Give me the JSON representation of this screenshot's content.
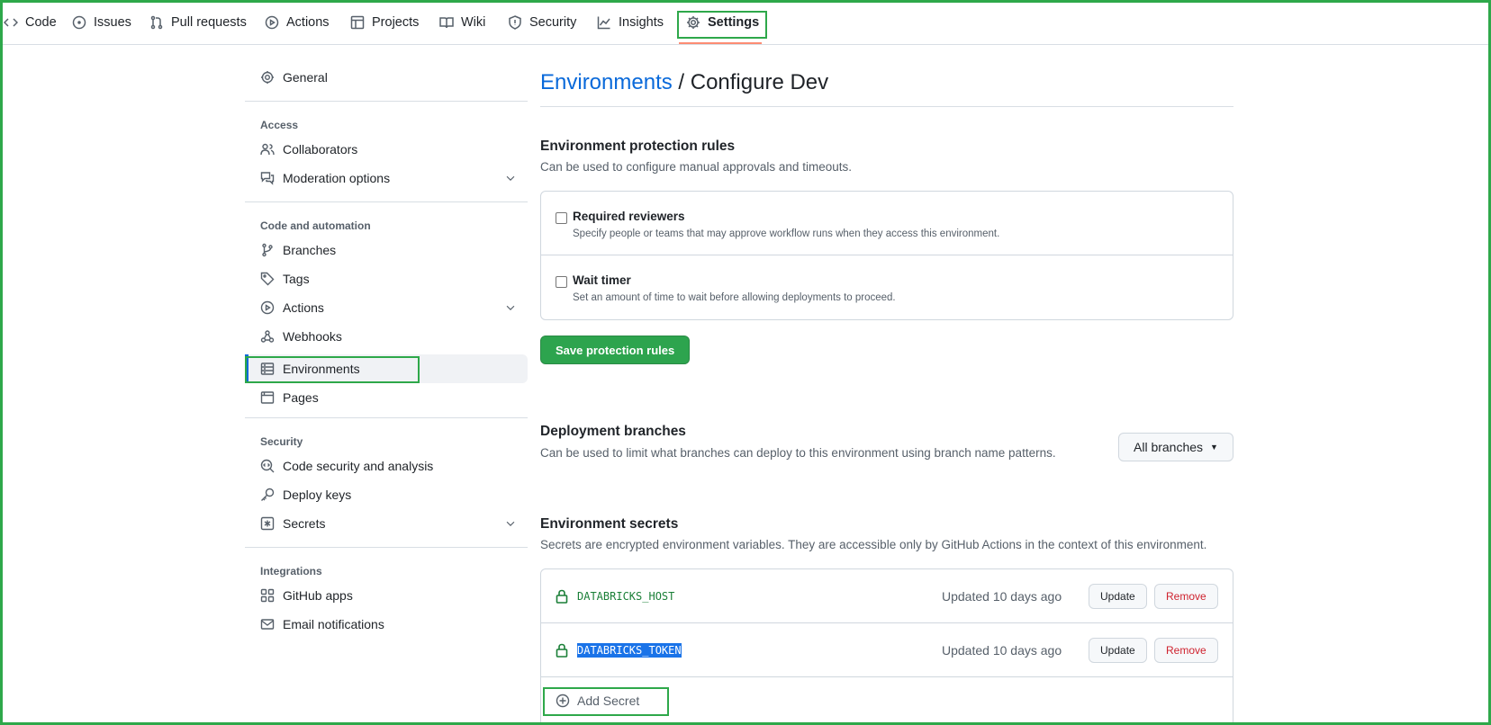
{
  "nav": {
    "tabs": [
      {
        "label": "Code",
        "icon": "code-icon"
      },
      {
        "label": "Issues",
        "icon": "issue-icon"
      },
      {
        "label": "Pull requests",
        "icon": "pull-request-icon"
      },
      {
        "label": "Actions",
        "icon": "play-icon"
      },
      {
        "label": "Projects",
        "icon": "table-icon"
      },
      {
        "label": "Wiki",
        "icon": "book-icon"
      },
      {
        "label": "Security",
        "icon": "shield-icon"
      },
      {
        "label": "Insights",
        "icon": "graph-icon"
      },
      {
        "label": "Settings",
        "icon": "gear-icon",
        "active": true
      }
    ]
  },
  "sidebar": {
    "general": "General",
    "access_heading": "Access",
    "collaborators": "Collaborators",
    "moderation": "Moderation options",
    "code_heading": "Code and automation",
    "branches": "Branches",
    "tags": "Tags",
    "actions": "Actions",
    "webhooks": "Webhooks",
    "environments": "Environments",
    "pages": "Pages",
    "security_heading": "Security",
    "code_security": "Code security and analysis",
    "deploy_keys": "Deploy keys",
    "secrets": "Secrets",
    "integrations_heading": "Integrations",
    "github_apps": "GitHub apps",
    "email_notifications": "Email notifications"
  },
  "main": {
    "breadcrumb_link": "Environments",
    "title_rest": " / Configure Dev",
    "protection": {
      "title": "Environment protection rules",
      "desc": "Can be used to configure manual approvals and timeouts.",
      "rules": [
        {
          "label": "Required reviewers",
          "desc": "Specify people or teams that may approve workflow runs when they access this environment.",
          "checked": false
        },
        {
          "label": "Wait timer",
          "desc": "Set an amount of time to wait before allowing deployments to proceed.",
          "checked": false
        }
      ],
      "save_label": "Save protection rules"
    },
    "branches": {
      "title": "Deployment branches",
      "desc": "Can be used to limit what branches can deploy to this environment using branch name patterns.",
      "select_label": "All branches"
    },
    "secrets": {
      "title": "Environment secrets",
      "desc": "Secrets are encrypted environment variables. They are accessible only by GitHub Actions in the context of this environment.",
      "items": [
        {
          "name": "DATABRICKS_HOST",
          "updated": "Updated 10 days ago",
          "update_label": "Update",
          "remove_label": "Remove"
        },
        {
          "name": "DATABRICKS_TOKEN",
          "updated": "Updated 10 days ago",
          "update_label": "Update",
          "remove_label": "Remove"
        }
      ],
      "add_label": "Add Secret"
    }
  },
  "colors": {
    "accent_link": "#0969da",
    "primary_button": "#2da44e",
    "highlight_box": "#2ea84a",
    "secret_name": "#1a7f37",
    "danger": "#cf222e"
  }
}
